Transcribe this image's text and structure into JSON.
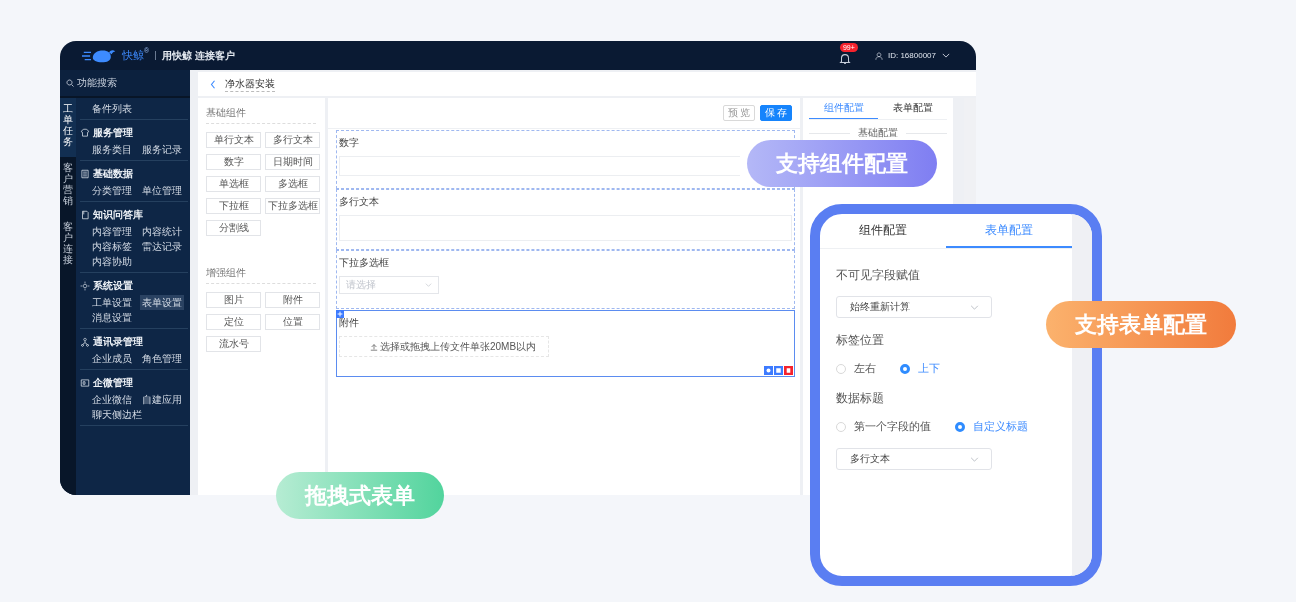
{
  "topbar": {
    "brand": "快鲸",
    "brand_mark": "®",
    "slogan": "用快鲸 连接客户",
    "badge": "99+",
    "user_id": "ID: 16800007"
  },
  "rail": [
    {
      "label": "工单任务",
      "selected": true
    },
    {
      "label": "客户营销",
      "selected": false
    },
    {
      "label": "客户连接",
      "selected": false
    }
  ],
  "sidebar": {
    "search_placeholder": "功能搜索",
    "sections": [
      {
        "items": [
          {
            "label": "备件列表",
            "selected": false
          }
        ]
      },
      {
        "title": "服务管理",
        "items": [
          {
            "label": "服务类目",
            "selected": false
          },
          {
            "label": "服务记录",
            "selected": false
          }
        ]
      },
      {
        "title": "基础数据",
        "items": [
          {
            "label": "分类管理",
            "selected": false
          },
          {
            "label": "单位管理",
            "selected": false
          }
        ]
      },
      {
        "title": "知识问答库",
        "items": [
          {
            "label": "内容管理",
            "selected": false
          },
          {
            "label": "内容统计",
            "selected": false
          },
          {
            "label": "内容标签",
            "selected": false
          },
          {
            "label": "雷达记录",
            "selected": false
          },
          {
            "label": "内容协助",
            "selected": false
          }
        ]
      },
      {
        "title": "系统设置",
        "items": [
          {
            "label": "工单设置",
            "selected": false
          },
          {
            "label": "表单设置",
            "selected": true
          },
          {
            "label": "消息设置",
            "selected": false
          }
        ]
      },
      {
        "title": "通讯录管理",
        "items": [
          {
            "label": "企业成员",
            "selected": false
          },
          {
            "label": "角色管理",
            "selected": false
          }
        ]
      },
      {
        "title": "企微管理",
        "items": [
          {
            "label": "企业微信",
            "selected": false
          },
          {
            "label": "自建应用",
            "selected": false
          },
          {
            "label": "聊天侧边栏",
            "selected": false
          }
        ]
      }
    ]
  },
  "page": {
    "title": "净水器安装"
  },
  "palette": {
    "groups": [
      {
        "title": "基础组件",
        "items": [
          "单行文本",
          "多行文本",
          "数字",
          "日期时间",
          "单选框",
          "多选框",
          "下拉框",
          "下拉多选框",
          "分割线"
        ]
      },
      {
        "title": "增强组件",
        "items": [
          "图片",
          "附件",
          "定位",
          "位置",
          "流水号"
        ]
      }
    ]
  },
  "canvas": {
    "preview": "预 览",
    "save": "保 存",
    "fields": [
      {
        "kind": "input",
        "label": "数字",
        "selected": false
      },
      {
        "kind": "textarea",
        "label": "多行文本",
        "selected": false
      },
      {
        "kind": "select",
        "label": "下拉多选框",
        "placeholder": "请选择",
        "selected": false
      },
      {
        "kind": "upload",
        "label": "附件",
        "button": "选择或拖拽上传文件单张20MB以内",
        "selected": true
      }
    ]
  },
  "config": {
    "tabs": [
      {
        "label": "组件配置",
        "selected": true
      },
      {
        "label": "表单配置",
        "selected": false
      }
    ],
    "section": "基础配置"
  },
  "zoom_panel": {
    "tabs": [
      {
        "label": "组件配置",
        "selected": false
      },
      {
        "label": "表单配置",
        "selected": true
      }
    ],
    "groups": [
      {
        "kind": "select",
        "label": "不可见字段赋值",
        "value": "始终重新计算"
      },
      {
        "kind": "radio",
        "label": "标签位置",
        "options": [
          {
            "label": "左右",
            "selected": false
          },
          {
            "label": "上下",
            "selected": true
          }
        ]
      },
      {
        "kind": "radio",
        "label": "数据标题",
        "options": [
          {
            "label": "第一个字段的值",
            "selected": false
          },
          {
            "label": "自定义标题",
            "selected": true
          }
        ]
      },
      {
        "kind": "select",
        "value": "多行文本"
      }
    ]
  },
  "callouts": [
    {
      "text": "支持组件配置",
      "kind": "purple"
    },
    {
      "text": "支持表单配置",
      "kind": "orange"
    },
    {
      "text": "拖拽式表单",
      "kind": "green"
    }
  ]
}
